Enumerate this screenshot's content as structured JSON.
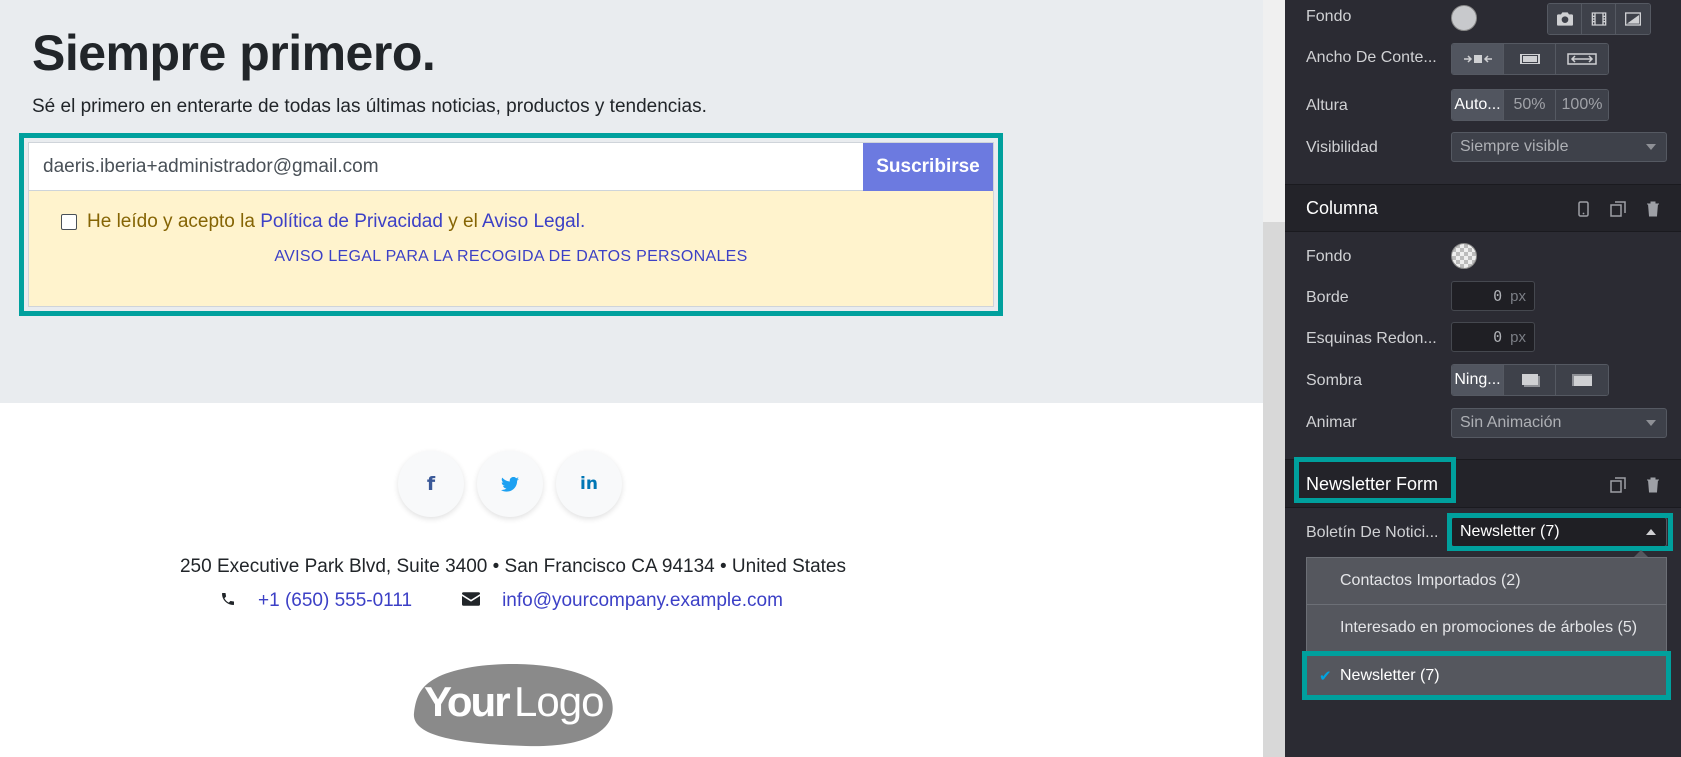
{
  "hero": {
    "title": "Siempre primero.",
    "subtitle": "Sé el primero en enterarte de todas las últimas noticias, productos y tendencias."
  },
  "newsletter_form": {
    "email_value": "daeris.iberia+administrador@gmail.com",
    "subscribe_label": "Suscribirse",
    "consent_prefix": "He leído y acepto la",
    "privacy_link": "Política de Privacidad",
    "consent_mid": "y el",
    "legal_link": "Aviso Legal",
    "consent_suffix": ".",
    "legal_notice": "AVISO LEGAL PARA LA RECOGIDA DE DATOS PERSONALES"
  },
  "footer": {
    "social": [
      {
        "icon": "facebook-icon",
        "glyph": "f",
        "color": "#3b5998"
      },
      {
        "icon": "twitter-icon",
        "glyph": "🐦",
        "color": "#1da1f2"
      },
      {
        "icon": "linkedin-icon",
        "glyph": "in",
        "color": "#0077b5"
      }
    ],
    "address": "250 Executive Park Blvd, Suite 3400 • San Francisco CA 94134 • United States",
    "phone": "+1 (650) 555-0111",
    "email": "info@yourcompany.example.com",
    "logo_text_bold": "Your",
    "logo_text_light": "Logo"
  },
  "panel": {
    "background": {
      "label": "Fondo"
    },
    "content_width": {
      "label": "Ancho De Conte..."
    },
    "height": {
      "label": "Altura",
      "options": [
        "Auto...",
        "50%",
        "100%"
      ]
    },
    "visibility": {
      "label": "Visibilidad",
      "value": "Siempre visible"
    },
    "column": {
      "title": "Columna",
      "fondo_label": "Fondo",
      "border_label": "Borde",
      "border_value": "0",
      "border_unit": "px",
      "radius_label": "Esquinas Redon...",
      "radius_value": "0",
      "radius_unit": "px",
      "shadow_label": "Sombra",
      "shadow_value": "Ning...",
      "animate_label": "Animar",
      "animate_value": "Sin Animación"
    },
    "newsletter": {
      "title": "Newsletter Form",
      "list_label": "Boletín De Notici...",
      "list_value": "Newsletter (7)",
      "options": [
        {
          "label": "Contactos Importados (2)",
          "selected": false
        },
        {
          "label": "Interesado en promociones de árboles (5)",
          "selected": false
        },
        {
          "label": "Newsletter (7)",
          "selected": true
        }
      ]
    },
    "colors": {
      "highlight": "#00a09d",
      "panel_bg": "#2b2b33",
      "accent_button": "#6c7ae0",
      "link": "#3c40c6"
    }
  }
}
